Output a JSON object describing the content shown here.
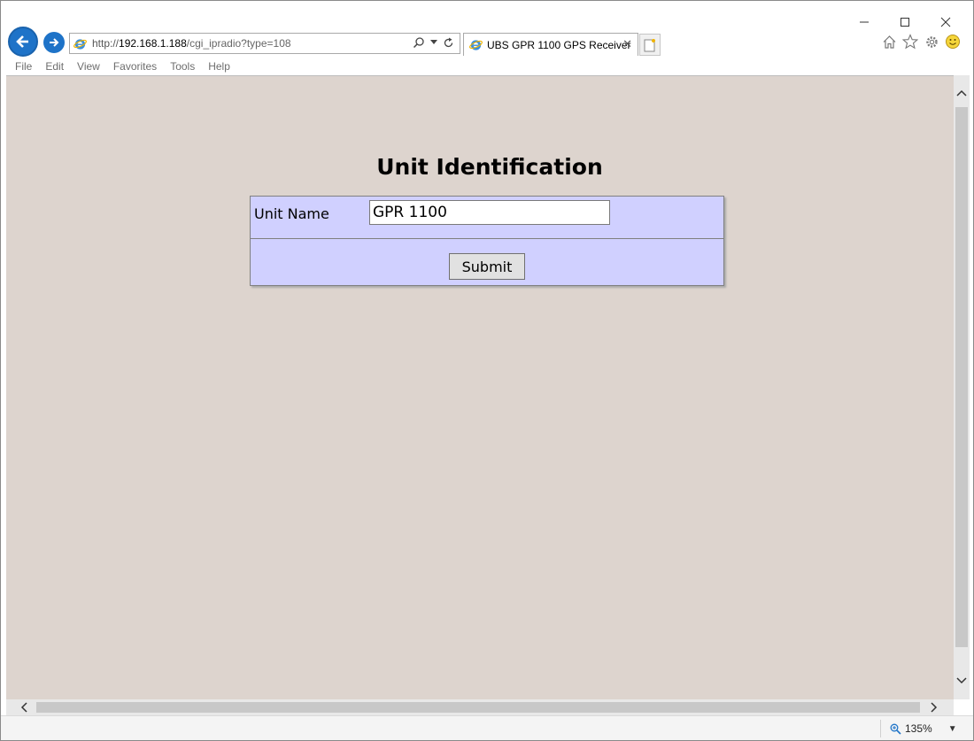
{
  "browser": {
    "address": {
      "scheme": "http://",
      "host": "192.168.1.188",
      "path": "/cgi_ipradio?type=108"
    },
    "tab": {
      "title": "UBS GPR 1100 GPS Receiver"
    },
    "menu": [
      "File",
      "Edit",
      "View",
      "Favorites",
      "Tools",
      "Help"
    ],
    "zoom": "135%",
    "icons": {
      "back": "back-arrow-icon",
      "forward": "forward-arrow-icon",
      "home": "home-icon",
      "favorites": "star-icon",
      "settings": "gear-icon",
      "feedback": "smiley-icon"
    }
  },
  "page": {
    "title": "Unit Identification",
    "form": {
      "unit_name_label": "Unit Name",
      "unit_name_value": "GPR 1100",
      "submit_label": "Submit"
    },
    "colors": {
      "page_bg": "#ddd4ce",
      "form_bg": "#d0d0ff"
    }
  }
}
